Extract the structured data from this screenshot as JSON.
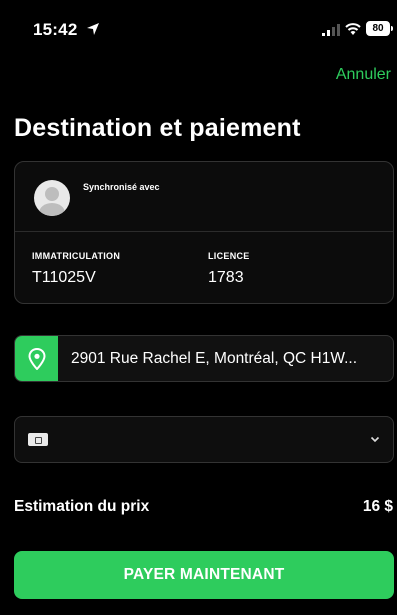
{
  "status_bar": {
    "time": "15:42",
    "battery": "80"
  },
  "header": {
    "cancel_label": "Annuler",
    "title": "Destination et paiement"
  },
  "driver_card": {
    "sync_label": "Synchronisé avec",
    "plate_label": "IMMATRICULATION",
    "plate_value": "T11025V",
    "license_label": "LICENCE",
    "license_value": "1783"
  },
  "destination": {
    "address": "2901 Rue Rachel E, Montréal, QC H1W..."
  },
  "payment": {
    "icon": "credit-card-icon"
  },
  "estimate": {
    "label": "Estimation du prix",
    "value": "16 $"
  },
  "pay_button": {
    "label": "PAYER MAINTENANT"
  },
  "colors": {
    "accent": "#2ecc5d",
    "background": "#000000",
    "card": "#0c0c0c"
  }
}
